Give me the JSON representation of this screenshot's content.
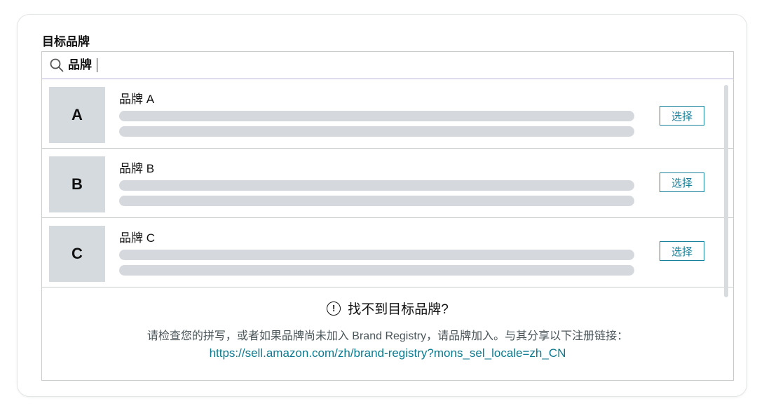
{
  "field": {
    "label": "目标品牌"
  },
  "search": {
    "value": "品牌"
  },
  "results": [
    {
      "initial": "A",
      "name": "品牌 A",
      "action": "选择"
    },
    {
      "initial": "B",
      "name": "品牌 B",
      "action": "选择"
    },
    {
      "initial": "C",
      "name": "品牌 C",
      "action": "选择"
    }
  ],
  "not_found": {
    "title": "找不到目标品牌?",
    "description": "请检查您的拼写，或者如果品牌尚未加入 Brand Registry，请品牌加入。与其分享以下注册链接：",
    "link": "https://sell.amazon.com/zh/brand-registry?mons_sel_locale=zh_CN"
  },
  "colors": {
    "accent": "#17809a",
    "link": "#0d7a8f",
    "placeholder": "#d5d9de"
  },
  "icons": {
    "search": "search-icon",
    "info": "info-icon"
  }
}
